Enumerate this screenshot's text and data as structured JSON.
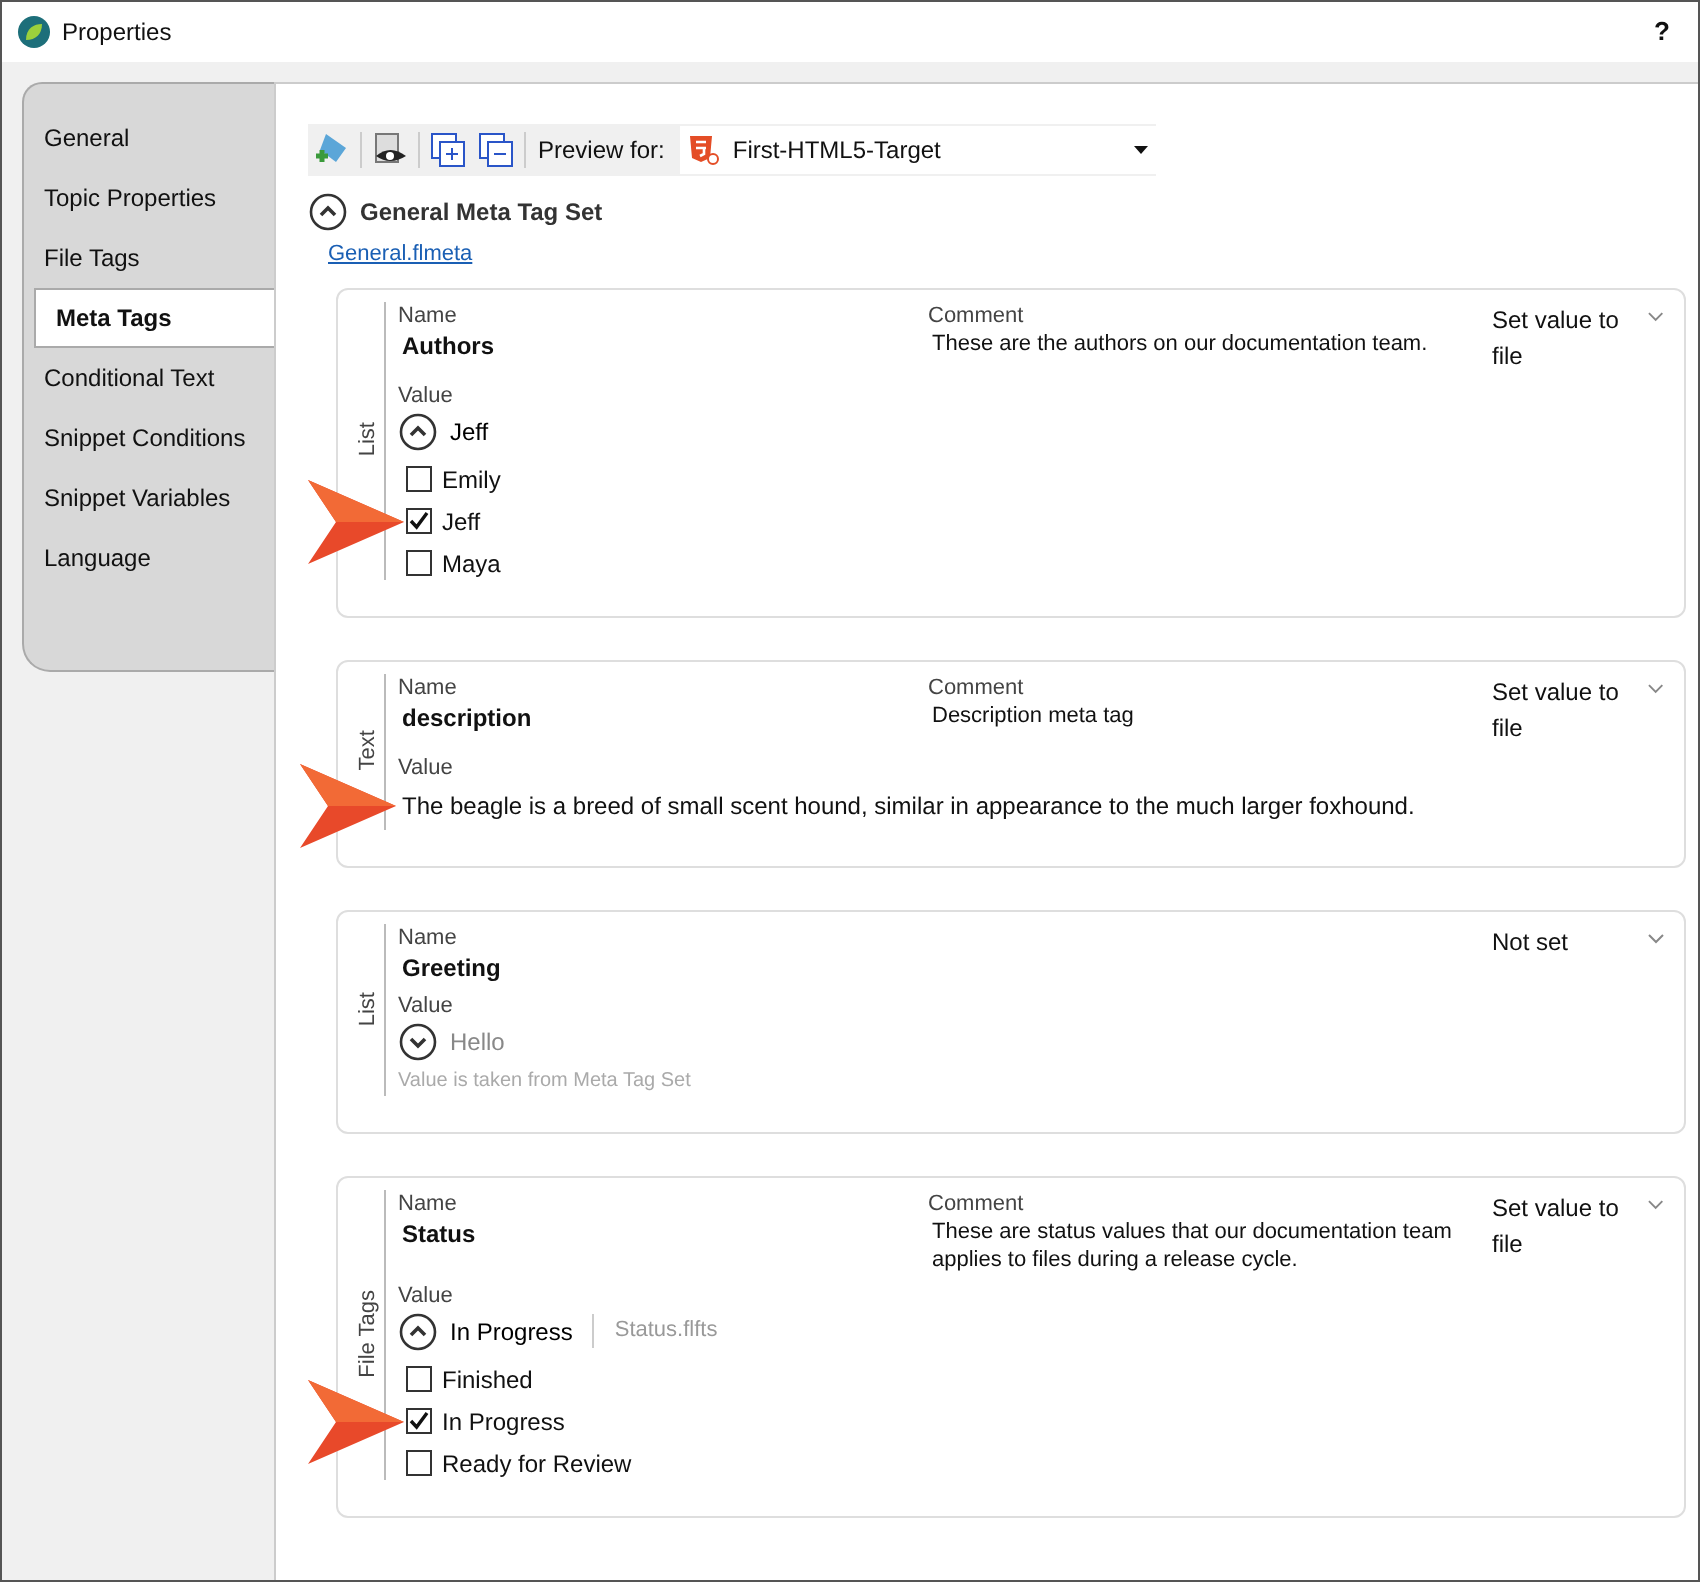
{
  "window": {
    "title": "Properties",
    "help": "?"
  },
  "sidebar": {
    "items": [
      {
        "label": "General",
        "selected": false
      },
      {
        "label": "Topic Properties",
        "selected": false
      },
      {
        "label": "File Tags",
        "selected": false
      },
      {
        "label": "Meta Tags",
        "selected": true
      },
      {
        "label": "Conditional Text",
        "selected": false
      },
      {
        "label": "Snippet Conditions",
        "selected": false
      },
      {
        "label": "Snippet Variables",
        "selected": false
      },
      {
        "label": "Language",
        "selected": false
      }
    ]
  },
  "toolbar": {
    "preview_label": "Preview for:",
    "preview_target": "First-HTML5-Target"
  },
  "section": {
    "title": "General Meta Tag Set",
    "expanded": true,
    "link": "General.flmeta"
  },
  "cards": [
    {
      "kind": "list",
      "type_label": "List",
      "name_label": "Name",
      "name": "Authors",
      "comment_label": "Comment",
      "comment": "These are the authors on our documentation team.",
      "mode": "Set value to file",
      "value_label": "Value",
      "value": "Jeff",
      "expanded": true,
      "options": [
        {
          "label": "Emily",
          "checked": false,
          "callout": false
        },
        {
          "label": "Jeff",
          "checked": true,
          "callout": true
        },
        {
          "label": "Maya",
          "checked": false,
          "callout": false
        }
      ]
    },
    {
      "kind": "text",
      "type_label": "Text",
      "name_label": "Name",
      "name": "description",
      "comment_label": "Comment",
      "comment": "Description meta tag",
      "mode": "Set value to file",
      "value_label": "Value",
      "value": "The beagle is a breed of small scent hound, similar in appearance to the much larger foxhound.",
      "callout": true
    },
    {
      "kind": "list",
      "type_label": "List",
      "name_label": "Name",
      "name": "Greeting",
      "mode": "Not set",
      "value_label": "Value",
      "value": "Hello",
      "expanded": false,
      "inherited": true,
      "note": "Value is taken from Meta Tag Set"
    },
    {
      "kind": "list",
      "type_label": "File Tags",
      "name_label": "Name",
      "name": "Status",
      "comment_label": "Comment",
      "comment": "These are status values that our documentation team applies to files during a release cycle.",
      "mode": "Set value to file",
      "value_label": "Value",
      "value": "In Progress",
      "source": "Status.flfts",
      "expanded": true,
      "options": [
        {
          "label": "Finished",
          "checked": false,
          "callout": false
        },
        {
          "label": "In Progress",
          "checked": true,
          "callout": true
        },
        {
          "label": "Ready for Review",
          "checked": false,
          "callout": false
        }
      ]
    }
  ]
}
